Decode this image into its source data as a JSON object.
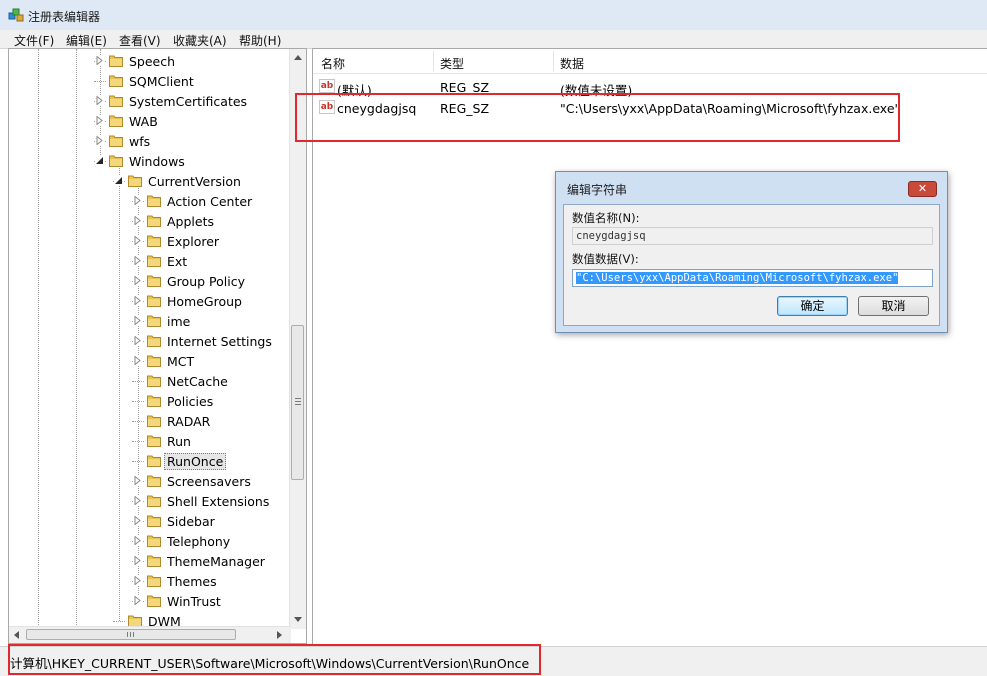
{
  "window": {
    "title": "注册表编辑器"
  },
  "menu": [
    "文件(F)",
    "编辑(E)",
    "查看(V)",
    "收藏夹(A)",
    "帮助(H)"
  ],
  "tree": [
    {
      "label": "Speech",
      "level": 1,
      "expander": "collapsed"
    },
    {
      "label": "SQMClient",
      "level": 1,
      "expander": "none"
    },
    {
      "label": "SystemCertificates",
      "level": 1,
      "expander": "collapsed"
    },
    {
      "label": "WAB",
      "level": 1,
      "expander": "collapsed"
    },
    {
      "label": "wfs",
      "level": 1,
      "expander": "collapsed"
    },
    {
      "label": "Windows",
      "level": 1,
      "expander": "expanded"
    },
    {
      "label": "CurrentVersion",
      "level": 2,
      "expander": "expanded"
    },
    {
      "label": "Action Center",
      "level": 3,
      "expander": "collapsed"
    },
    {
      "label": "Applets",
      "level": 3,
      "expander": "collapsed"
    },
    {
      "label": "Explorer",
      "level": 3,
      "expander": "collapsed"
    },
    {
      "label": "Ext",
      "level": 3,
      "expander": "collapsed"
    },
    {
      "label": "Group Policy",
      "level": 3,
      "expander": "collapsed"
    },
    {
      "label": "HomeGroup",
      "level": 3,
      "expander": "collapsed"
    },
    {
      "label": "ime",
      "level": 3,
      "expander": "collapsed"
    },
    {
      "label": "Internet Settings",
      "level": 3,
      "expander": "collapsed"
    },
    {
      "label": "MCT",
      "level": 3,
      "expander": "collapsed"
    },
    {
      "label": "NetCache",
      "level": 3,
      "expander": "none"
    },
    {
      "label": "Policies",
      "level": 3,
      "expander": "none"
    },
    {
      "label": "RADAR",
      "level": 3,
      "expander": "none"
    },
    {
      "label": "Run",
      "level": 3,
      "expander": "none"
    },
    {
      "label": "RunOnce",
      "level": 3,
      "expander": "none",
      "selected": true
    },
    {
      "label": "Screensavers",
      "level": 3,
      "expander": "collapsed"
    },
    {
      "label": "Shell Extensions",
      "level": 3,
      "expander": "collapsed"
    },
    {
      "label": "Sidebar",
      "level": 3,
      "expander": "collapsed"
    },
    {
      "label": "Telephony",
      "level": 3,
      "expander": "collapsed"
    },
    {
      "label": "ThemeManager",
      "level": 3,
      "expander": "collapsed"
    },
    {
      "label": "Themes",
      "level": 3,
      "expander": "collapsed"
    },
    {
      "label": "WinTrust",
      "level": 3,
      "expander": "collapsed"
    },
    {
      "label": "DWM",
      "level": 2,
      "expander": "none"
    }
  ],
  "list": {
    "columns": [
      "名称",
      "类型",
      "数据"
    ],
    "rows": [
      {
        "name": "(默认)",
        "type": "REG_SZ",
        "data": "(数值未设置)"
      },
      {
        "name": "cneygdagjsq",
        "type": "REG_SZ",
        "data": "\"C:\\Users\\yxx\\AppData\\Roaming\\Microsoft\\fyhzax.exe\""
      }
    ]
  },
  "dialog": {
    "title": "编辑字符串",
    "name_label": "数值名称(N):",
    "name_value": "cneygdagjsq",
    "data_label": "数值数据(V):",
    "data_value": "\"C:\\Users\\yxx\\AppData\\Roaming\\Microsoft\\fyhzax.exe\"",
    "ok_label": "确定",
    "cancel_label": "取消"
  },
  "status": {
    "path": "计算机\\HKEY_CURRENT_USER\\Software\\Microsoft\\Windows\\CurrentVersion\\RunOnce"
  },
  "colors": {
    "highlight_box": "#e0282e",
    "folder": "#e8c254",
    "selection": "#3399ff"
  }
}
